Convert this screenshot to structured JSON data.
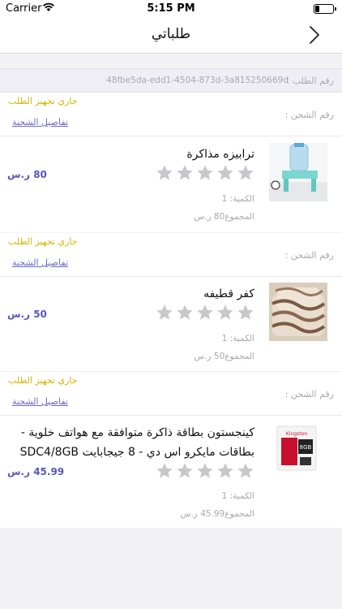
{
  "status_bar": {
    "carrier": "Carrier",
    "time": "5:15 PM"
  },
  "nav": {
    "title": "طلباتي"
  },
  "order": {
    "number_label": "رقم الطلب :",
    "number": "48fbe5da-edd1-4504-873d-3a815250669d"
  },
  "shipments": [
    {
      "status": "جاري تجهيز الطلب",
      "shipping_label": "رقم الشحن :",
      "details_link": "تفاصيل الشحنة",
      "item": {
        "name": "ترابيزه مذاكرة",
        "price": "80 ر.س",
        "rating": 0,
        "quantity": "الكمية: 1",
        "total": "المجموع80 ر.س"
      }
    },
    {
      "status": "جاري تجهيز الطلب",
      "shipping_label": "رقم الشحن :",
      "details_link": "تفاصيل الشحنة",
      "item": {
        "name": "كفر قطيفه",
        "price": "50 ر.س",
        "rating": 0,
        "quantity": "الكمية: 1",
        "total": "المجموع50 ر.س"
      }
    },
    {
      "status": "جاري تجهيز الطلب",
      "shipping_label": "رقم الشحن :",
      "details_link": "تفاصيل الشحنة",
      "item": {
        "name_line1": "كينجستون بطاقة ذاكرة متوافقة مع هواتف خلوية -",
        "name_line2": "بطاقات مايكرو اس دي - 8 جيجابايت SDC4/8GB",
        "price": "45.99 ر.س",
        "rating": 0,
        "quantity": "الكمية: 1",
        "total": "المجموع45.99 ر.س",
        "card_brand": "Kingston",
        "card_capacity": "8GB"
      }
    }
  ],
  "colors": {
    "status": "#d4b400",
    "link": "#6a68c8",
    "price": "#5a55c0",
    "star": "#c8c8cc"
  }
}
